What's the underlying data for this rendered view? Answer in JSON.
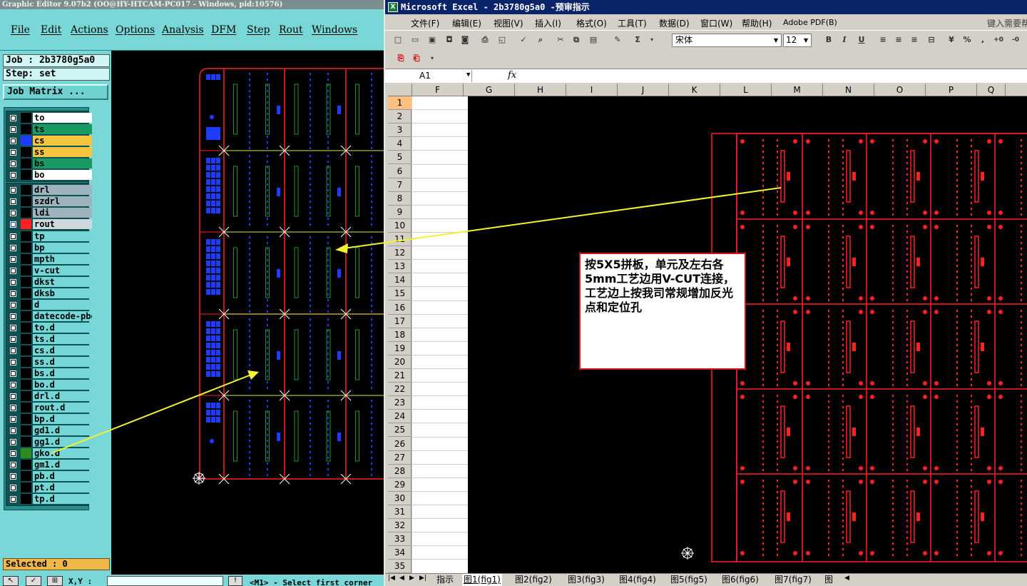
{
  "graphic_editor": {
    "title": "Graphic Editor 9.07b2  (OO@HY-HTCAM-PC017 - Windows, pid:10576)",
    "menu": [
      "File",
      "Edit",
      "Actions",
      "Options",
      "Analysis",
      "DFM",
      "Step",
      "Rout",
      "Windows"
    ],
    "job": "Job : 2b3780g5a0",
    "step": "Step: set",
    "job_matrix": "Job Matrix ...",
    "layer_groups": [
      [
        {
          "name": "to",
          "swatch": "#000000",
          "bg": "#ffffff"
        },
        {
          "name": "ts",
          "swatch": "#000000",
          "bg": "#1a9a62"
        },
        {
          "name": "cs",
          "swatch": "#1e3cff",
          "bg": "#f5c542"
        },
        {
          "name": "ss",
          "swatch": "#000000",
          "bg": "#f5c542"
        },
        {
          "name": "bs",
          "swatch": "#000000",
          "bg": "#1a9a62"
        },
        {
          "name": "bo",
          "swatch": "#000000",
          "bg": "#ffffff"
        }
      ],
      [
        {
          "name": "drl",
          "swatch": "#000000",
          "bg": "#9fb3bf"
        },
        {
          "name": "szdrl",
          "swatch": "#000000",
          "bg": "#9fb3bf"
        },
        {
          "name": "ldi",
          "swatch": "#000000",
          "bg": "#9fb3bf"
        },
        {
          "name": "rout",
          "swatch": "#ff2020",
          "bg": "#cfd8dd",
          "cb_color": "#1e3cff"
        }
      ],
      [
        {
          "name": "tp",
          "swatch": "#000000",
          "bg": "#74d6d6"
        },
        {
          "name": "bp",
          "swatch": "#000000",
          "bg": "#74d6d6"
        },
        {
          "name": "mpth",
          "swatch": "#000000",
          "bg": "#74d6d6"
        },
        {
          "name": "v-cut",
          "swatch": "#000000",
          "bg": "#74d6d6"
        },
        {
          "name": "dkst",
          "swatch": "#000000",
          "bg": "#74d6d6"
        },
        {
          "name": "dksb",
          "swatch": "#000000",
          "bg": "#74d6d6"
        },
        {
          "name": "d",
          "swatch": "#000000",
          "bg": "#74d6d6"
        },
        {
          "name": "datecode-pbe",
          "swatch": "#000000",
          "bg": "#74d6d6"
        },
        {
          "name": "to.d",
          "swatch": "#000000",
          "bg": "#74d6d6"
        },
        {
          "name": "ts.d",
          "swatch": "#000000",
          "bg": "#74d6d6"
        },
        {
          "name": "cs.d",
          "swatch": "#000000",
          "bg": "#74d6d6"
        },
        {
          "name": "ss.d",
          "swatch": "#000000",
          "bg": "#74d6d6"
        },
        {
          "name": "bs.d",
          "swatch": "#000000",
          "bg": "#74d6d6"
        },
        {
          "name": "bo.d",
          "swatch": "#000000",
          "bg": "#74d6d6"
        },
        {
          "name": "drl.d",
          "swatch": "#000000",
          "bg": "#74d6d6"
        },
        {
          "name": "rout.d",
          "swatch": "#000000",
          "bg": "#74d6d6"
        },
        {
          "name": "bp.d",
          "swatch": "#000000",
          "bg": "#74d6d6"
        },
        {
          "name": "gd1.d",
          "swatch": "#000000",
          "bg": "#74d6d6"
        },
        {
          "name": "gg1.d",
          "swatch": "#000000",
          "bg": "#74d6d6"
        },
        {
          "name": "gko.d",
          "swatch": "#2e8b1e",
          "bg": "#74d6d6"
        },
        {
          "name": "gm1.d",
          "swatch": "#000000",
          "bg": "#74d6d6"
        },
        {
          "name": "pb.d",
          "swatch": "#000000",
          "bg": "#74d6d6"
        },
        {
          "name": "pt.d",
          "swatch": "#000000",
          "bg": "#74d6d6"
        },
        {
          "name": "tp.d",
          "swatch": "#000000",
          "bg": "#74d6d6"
        }
      ]
    ],
    "selected": "Selected : 0",
    "status_xy": "X,Y :",
    "status_msg": "<M1> - Select first corner"
  },
  "excel": {
    "title": "Microsoft Excel - 2b3780g5a0 -预审指示",
    "menu": [
      "文件(F)",
      "编辑(E)",
      "视图(V)",
      "插入(I)",
      "格式(O)",
      "工具(T)",
      "数据(D)",
      "窗口(W)",
      "帮助(H)",
      "Adobe PDF(B)"
    ],
    "help_prompt": "键入需要帮",
    "font": "宋体",
    "font_size": "12",
    "name_box": "A1",
    "fx": "fx",
    "columns": [
      "F",
      "G",
      "H",
      "I",
      "J",
      "K",
      "L",
      "M",
      "N",
      "O",
      "P",
      "Q"
    ],
    "rows": [
      "1",
      "2",
      "3",
      "4",
      "5",
      "6",
      "7",
      "8",
      "9",
      "10",
      "11",
      "12",
      "13",
      "14",
      "15",
      "16",
      "17",
      "18",
      "19",
      "20",
      "21",
      "22",
      "23",
      "24",
      "25",
      "26",
      "27",
      "28",
      "29",
      "30",
      "31",
      "32",
      "33",
      "34",
      "35"
    ],
    "note": "按5X5拼板，单元及左右各5mm工艺边用V-CUT连接，工艺边上按我司常规增加反光点和定位孔",
    "sheet_tabs": [
      "指示",
      "图1(fig1)",
      "图2(fig2)",
      "图3(fig3)",
      "图4(fig4)",
      "图5(fig5)",
      "图6(fig6)",
      "图7(fig7)",
      "图"
    ],
    "active_tab": 1
  },
  "colors": {
    "outline": "#ff2020",
    "blue_pads": "#1e3cff",
    "green_slots": "#1f9a1f",
    "arrow": "#f2f230",
    "vcut_marker": "#ffffff"
  }
}
